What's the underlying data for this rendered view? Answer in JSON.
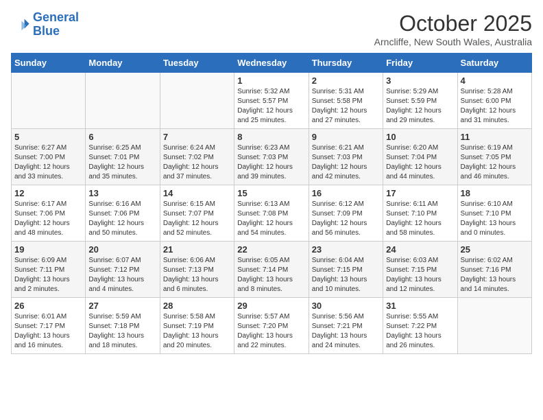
{
  "header": {
    "logo_line1": "General",
    "logo_line2": "Blue",
    "month": "October 2025",
    "location": "Arncliffe, New South Wales, Australia"
  },
  "weekdays": [
    "Sunday",
    "Monday",
    "Tuesday",
    "Wednesday",
    "Thursday",
    "Friday",
    "Saturday"
  ],
  "weeks": [
    [
      {
        "day": "",
        "sunrise": "",
        "sunset": "",
        "daylight": ""
      },
      {
        "day": "",
        "sunrise": "",
        "sunset": "",
        "daylight": ""
      },
      {
        "day": "",
        "sunrise": "",
        "sunset": "",
        "daylight": ""
      },
      {
        "day": "1",
        "sunrise": "Sunrise: 5:32 AM",
        "sunset": "Sunset: 5:57 PM",
        "daylight": "Daylight: 12 hours and 25 minutes."
      },
      {
        "day": "2",
        "sunrise": "Sunrise: 5:31 AM",
        "sunset": "Sunset: 5:58 PM",
        "daylight": "Daylight: 12 hours and 27 minutes."
      },
      {
        "day": "3",
        "sunrise": "Sunrise: 5:29 AM",
        "sunset": "Sunset: 5:59 PM",
        "daylight": "Daylight: 12 hours and 29 minutes."
      },
      {
        "day": "4",
        "sunrise": "Sunrise: 5:28 AM",
        "sunset": "Sunset: 6:00 PM",
        "daylight": "Daylight: 12 hours and 31 minutes."
      }
    ],
    [
      {
        "day": "5",
        "sunrise": "Sunrise: 6:27 AM",
        "sunset": "Sunset: 7:00 PM",
        "daylight": "Daylight: 12 hours and 33 minutes."
      },
      {
        "day": "6",
        "sunrise": "Sunrise: 6:25 AM",
        "sunset": "Sunset: 7:01 PM",
        "daylight": "Daylight: 12 hours and 35 minutes."
      },
      {
        "day": "7",
        "sunrise": "Sunrise: 6:24 AM",
        "sunset": "Sunset: 7:02 PM",
        "daylight": "Daylight: 12 hours and 37 minutes."
      },
      {
        "day": "8",
        "sunrise": "Sunrise: 6:23 AM",
        "sunset": "Sunset: 7:03 PM",
        "daylight": "Daylight: 12 hours and 39 minutes."
      },
      {
        "day": "9",
        "sunrise": "Sunrise: 6:21 AM",
        "sunset": "Sunset: 7:03 PM",
        "daylight": "Daylight: 12 hours and 42 minutes."
      },
      {
        "day": "10",
        "sunrise": "Sunrise: 6:20 AM",
        "sunset": "Sunset: 7:04 PM",
        "daylight": "Daylight: 12 hours and 44 minutes."
      },
      {
        "day": "11",
        "sunrise": "Sunrise: 6:19 AM",
        "sunset": "Sunset: 7:05 PM",
        "daylight": "Daylight: 12 hours and 46 minutes."
      }
    ],
    [
      {
        "day": "12",
        "sunrise": "Sunrise: 6:17 AM",
        "sunset": "Sunset: 7:06 PM",
        "daylight": "Daylight: 12 hours and 48 minutes."
      },
      {
        "day": "13",
        "sunrise": "Sunrise: 6:16 AM",
        "sunset": "Sunset: 7:06 PM",
        "daylight": "Daylight: 12 hours and 50 minutes."
      },
      {
        "day": "14",
        "sunrise": "Sunrise: 6:15 AM",
        "sunset": "Sunset: 7:07 PM",
        "daylight": "Daylight: 12 hours and 52 minutes."
      },
      {
        "day": "15",
        "sunrise": "Sunrise: 6:13 AM",
        "sunset": "Sunset: 7:08 PM",
        "daylight": "Daylight: 12 hours and 54 minutes."
      },
      {
        "day": "16",
        "sunrise": "Sunrise: 6:12 AM",
        "sunset": "Sunset: 7:09 PM",
        "daylight": "Daylight: 12 hours and 56 minutes."
      },
      {
        "day": "17",
        "sunrise": "Sunrise: 6:11 AM",
        "sunset": "Sunset: 7:10 PM",
        "daylight": "Daylight: 12 hours and 58 minutes."
      },
      {
        "day": "18",
        "sunrise": "Sunrise: 6:10 AM",
        "sunset": "Sunset: 7:10 PM",
        "daylight": "Daylight: 13 hours and 0 minutes."
      }
    ],
    [
      {
        "day": "19",
        "sunrise": "Sunrise: 6:09 AM",
        "sunset": "Sunset: 7:11 PM",
        "daylight": "Daylight: 13 hours and 2 minutes."
      },
      {
        "day": "20",
        "sunrise": "Sunrise: 6:07 AM",
        "sunset": "Sunset: 7:12 PM",
        "daylight": "Daylight: 13 hours and 4 minutes."
      },
      {
        "day": "21",
        "sunrise": "Sunrise: 6:06 AM",
        "sunset": "Sunset: 7:13 PM",
        "daylight": "Daylight: 13 hours and 6 minutes."
      },
      {
        "day": "22",
        "sunrise": "Sunrise: 6:05 AM",
        "sunset": "Sunset: 7:14 PM",
        "daylight": "Daylight: 13 hours and 8 minutes."
      },
      {
        "day": "23",
        "sunrise": "Sunrise: 6:04 AM",
        "sunset": "Sunset: 7:15 PM",
        "daylight": "Daylight: 13 hours and 10 minutes."
      },
      {
        "day": "24",
        "sunrise": "Sunrise: 6:03 AM",
        "sunset": "Sunset: 7:15 PM",
        "daylight": "Daylight: 13 hours and 12 minutes."
      },
      {
        "day": "25",
        "sunrise": "Sunrise: 6:02 AM",
        "sunset": "Sunset: 7:16 PM",
        "daylight": "Daylight: 13 hours and 14 minutes."
      }
    ],
    [
      {
        "day": "26",
        "sunrise": "Sunrise: 6:01 AM",
        "sunset": "Sunset: 7:17 PM",
        "daylight": "Daylight: 13 hours and 16 minutes."
      },
      {
        "day": "27",
        "sunrise": "Sunrise: 5:59 AM",
        "sunset": "Sunset: 7:18 PM",
        "daylight": "Daylight: 13 hours and 18 minutes."
      },
      {
        "day": "28",
        "sunrise": "Sunrise: 5:58 AM",
        "sunset": "Sunset: 7:19 PM",
        "daylight": "Daylight: 13 hours and 20 minutes."
      },
      {
        "day": "29",
        "sunrise": "Sunrise: 5:57 AM",
        "sunset": "Sunset: 7:20 PM",
        "daylight": "Daylight: 13 hours and 22 minutes."
      },
      {
        "day": "30",
        "sunrise": "Sunrise: 5:56 AM",
        "sunset": "Sunset: 7:21 PM",
        "daylight": "Daylight: 13 hours and 24 minutes."
      },
      {
        "day": "31",
        "sunrise": "Sunrise: 5:55 AM",
        "sunset": "Sunset: 7:22 PM",
        "daylight": "Daylight: 13 hours and 26 minutes."
      },
      {
        "day": "",
        "sunrise": "",
        "sunset": "",
        "daylight": ""
      }
    ]
  ]
}
